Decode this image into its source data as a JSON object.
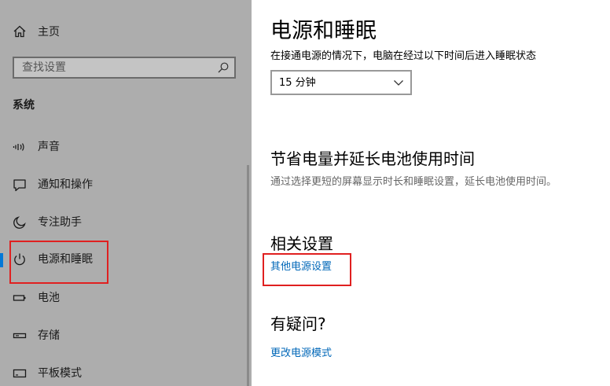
{
  "sidebar": {
    "home_label": "主页",
    "search_placeholder": "查找设置",
    "section_title": "系统",
    "items": [
      {
        "label": "声音",
        "icon": "speaker-icon"
      },
      {
        "label": "通知和操作",
        "icon": "notification-icon"
      },
      {
        "label": "专注助手",
        "icon": "moon-icon"
      },
      {
        "label": "电源和睡眠",
        "icon": "power-icon",
        "active": true
      },
      {
        "label": "电池",
        "icon": "battery-icon"
      },
      {
        "label": "存储",
        "icon": "storage-icon"
      },
      {
        "label": "平板模式",
        "icon": "tablet-icon"
      }
    ]
  },
  "main": {
    "title": "电源和睡眠",
    "sleep_description": "在接通电源的情况下，电脑在经过以下时间后进入睡眠状态",
    "sleep_dropdown_value": "15 分钟",
    "battery_heading": "节省电量并延长电池使用时间",
    "battery_description": "通过选择更短的屏幕显示时长和睡眠设置，延长电池使用时间。",
    "related_heading": "相关设置",
    "other_power_link": "其他电源设置",
    "question_heading": "有疑问?",
    "change_power_mode_link": "更改电源模式"
  },
  "colors": {
    "sidebar_bg": "#adadad",
    "accent": "#0078d7",
    "link": "#0067b8",
    "highlight": "#e02020"
  }
}
